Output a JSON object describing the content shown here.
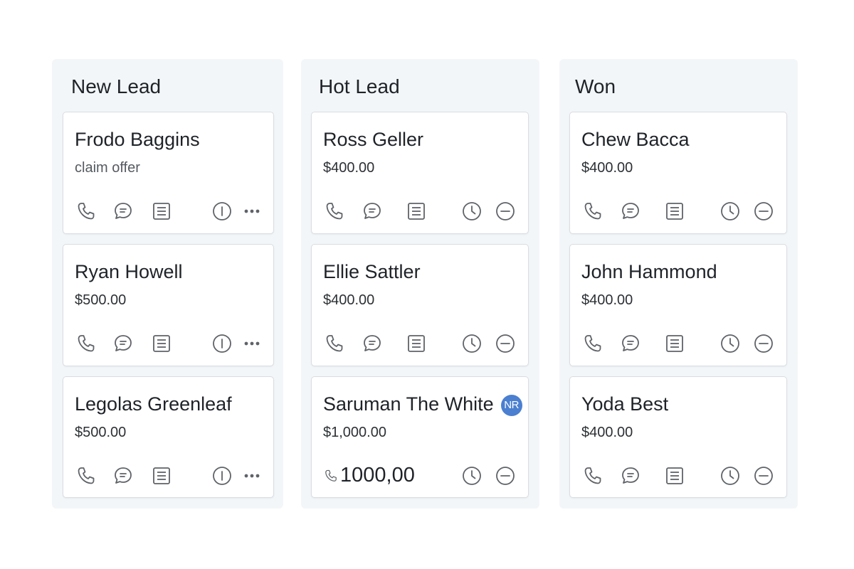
{
  "columns": [
    {
      "title": "New Lead",
      "cards": [
        {
          "name": "Frodo Baggins",
          "subtitle": "claim offer"
        },
        {
          "name": "Ryan Howell",
          "subtitle": "$500.00"
        },
        {
          "name": "Legolas Greenleaf",
          "subtitle": "$500.00"
        }
      ],
      "card_actions": [
        "phone-icon",
        "chat-icon",
        "notes-icon",
        "info-icon",
        "more-icon"
      ]
    },
    {
      "title": "Hot Lead",
      "cards": [
        {
          "name": "Ross Geller",
          "subtitle": "$400.00"
        },
        {
          "name": "Ellie Sattler",
          "subtitle": "$400.00"
        },
        {
          "name": "Saruman The White",
          "subtitle": "$1,000.00",
          "badge": "NR",
          "footer_amount": "1000,00"
        }
      ],
      "card_actions": [
        "phone-icon",
        "chat-icon",
        "notes-icon",
        "clock-icon",
        "minus-circle-icon"
      ]
    },
    {
      "title": "Won",
      "cards": [
        {
          "name": "Chew Bacca",
          "subtitle": "$400.00"
        },
        {
          "name": "John Hammond",
          "subtitle": "$400.00"
        },
        {
          "name": "Yoda Best",
          "subtitle": "$400.00"
        }
      ],
      "card_actions": [
        "phone-icon",
        "chat-icon",
        "notes-icon",
        "clock-icon",
        "minus-circle-icon"
      ]
    }
  ],
  "colors": {
    "board_background": "#f3f6f9",
    "card_border": "#d9dde2",
    "icon_stroke": "#5f6368",
    "badge": "#4b7fd0"
  }
}
